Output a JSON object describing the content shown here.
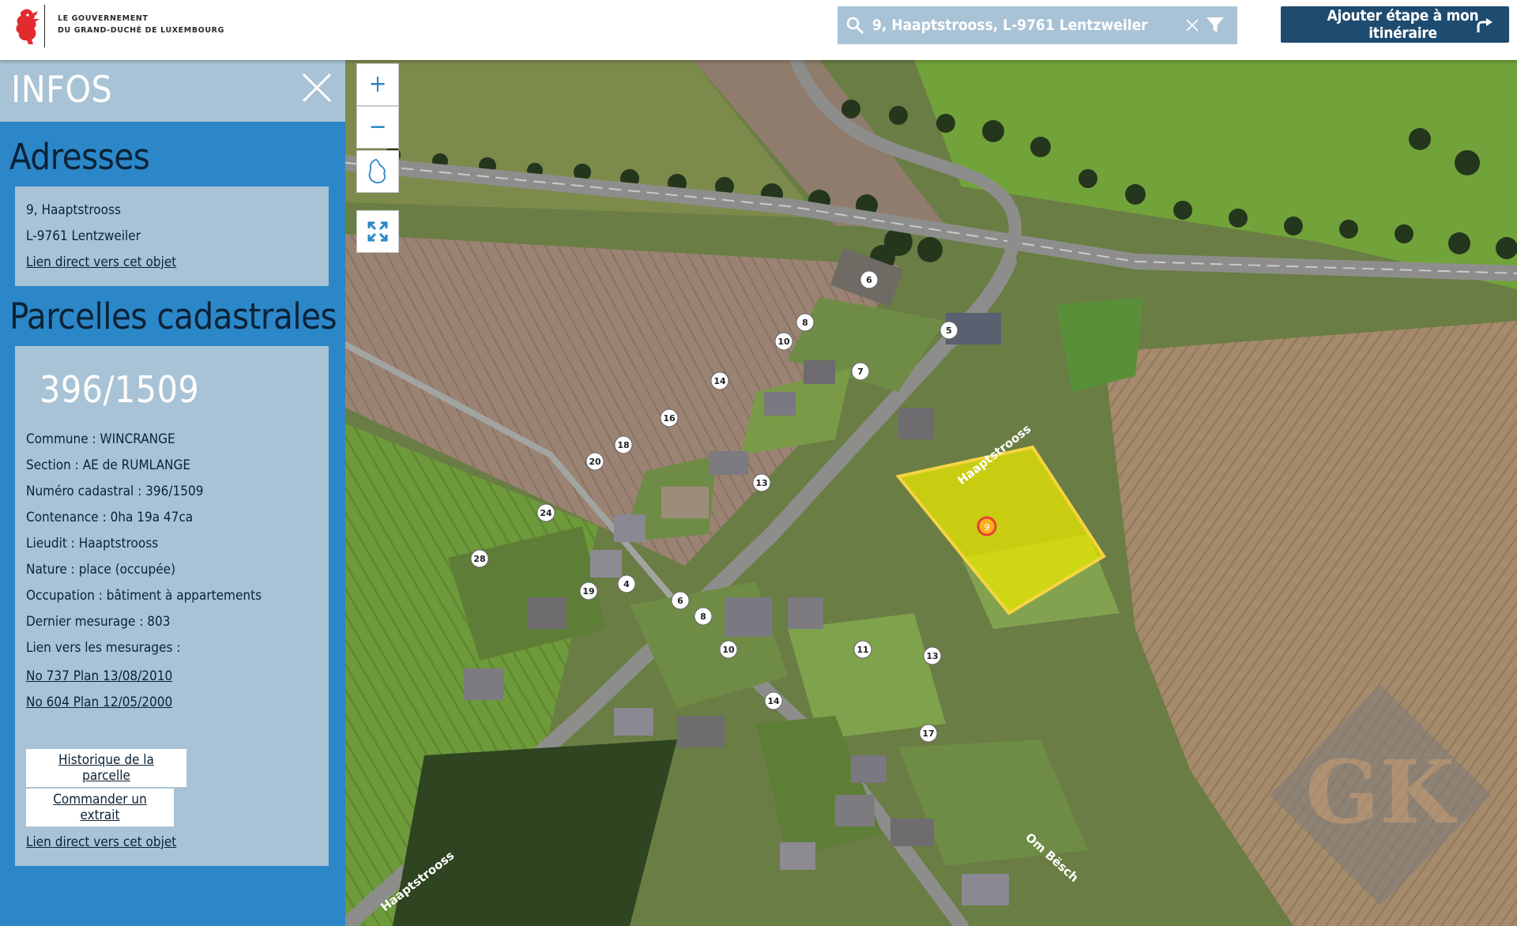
{
  "header": {
    "gov_line1": "LE GOUVERNEMENT",
    "gov_line2": "DU GRAND-DUCHÉ DE LUXEMBOURG",
    "search_value": "9, Haaptstrooss, L-9761 Lentzweiler",
    "itinerary_button": "Ajouter étape à mon itinéraire"
  },
  "sidebar": {
    "title": "INFOS",
    "adresses": {
      "title": "Adresses",
      "line1": "9, Haaptstrooss",
      "line2": "L-9761 Lentzweiler",
      "link": "Lien direct vers cet objet"
    },
    "parcelles": {
      "title": "Parcelles cadastrales",
      "number": "396/1509",
      "commune": "Commune : WINCRANGE",
      "section": "Section : AE de RUMLANGE",
      "numero": "Numéro cadastral : 396/1509",
      "contenance": "Contenance : 0ha 19a 47ca",
      "lieudit": "Lieudit : Haaptstrooss",
      "nature": "Nature : place (occupée)",
      "occupation": "Occupation : bâtiment à appartements",
      "dernier": "Dernier mesurage : 803",
      "mesurages_label": "Lien vers les mesurages :",
      "mesurage1": "No 737 Plan 13/08/2010",
      "mesurage2": "No 604 Plan 12/05/2000",
      "history_button": "Historique de la parcelle",
      "order_button": "Commander un extrait",
      "link": "Lien direct vers cet objet"
    }
  },
  "map": {
    "zoom_in": "+",
    "zoom_out": "−",
    "street_main": "Haaptstrooss",
    "street_main_2": "Haaptstrooss",
    "street_side": "Om Bësch",
    "selected_marker": "9",
    "house_numbers": [
      "6",
      "8",
      "10",
      "5",
      "7",
      "14",
      "16",
      "18",
      "20",
      "24",
      "28",
      "13",
      "19",
      "4",
      "6",
      "8",
      "10",
      "11",
      "13",
      "14",
      "17"
    ],
    "watermark": "GK"
  },
  "colors": {
    "accent_blue": "#2b87c8",
    "light_blue": "#a9c3d6",
    "dark_blue": "#1e4b70",
    "parcel_yellow": "#e8e800"
  }
}
